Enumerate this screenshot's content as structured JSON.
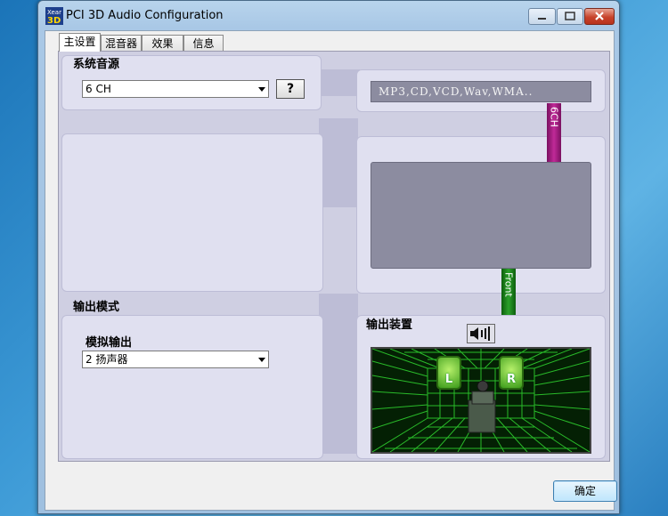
{
  "window": {
    "title": "PCI 3D Audio Configuration",
    "icon": "xear-3d-app-icon"
  },
  "tabs": [
    {
      "label": "主设置",
      "active": true
    },
    {
      "label": "混音器",
      "active": false
    },
    {
      "label": "效果",
      "active": false
    },
    {
      "label": "信息",
      "active": false
    }
  ],
  "system_audio": {
    "heading": "系统音源",
    "selected": "6 CH",
    "help_label": "?",
    "source_text": "MP3,CD,VCD,Wav,WMA.."
  },
  "output_mode": {
    "heading": "输出模式",
    "analog_label": "模拟输出",
    "selected": "2 扬声器"
  },
  "output_device": {
    "heading": "输出装置",
    "speaker_left": "L",
    "speaker_right": "R"
  },
  "signal_bars": {
    "top": "6CH",
    "front": "Front"
  },
  "colors": {
    "bar_6ch": "#a0207e",
    "bar_front": "#1f8a1f",
    "grid_green": "#2ecc2e"
  },
  "footer": {
    "ok_label": "确定"
  }
}
